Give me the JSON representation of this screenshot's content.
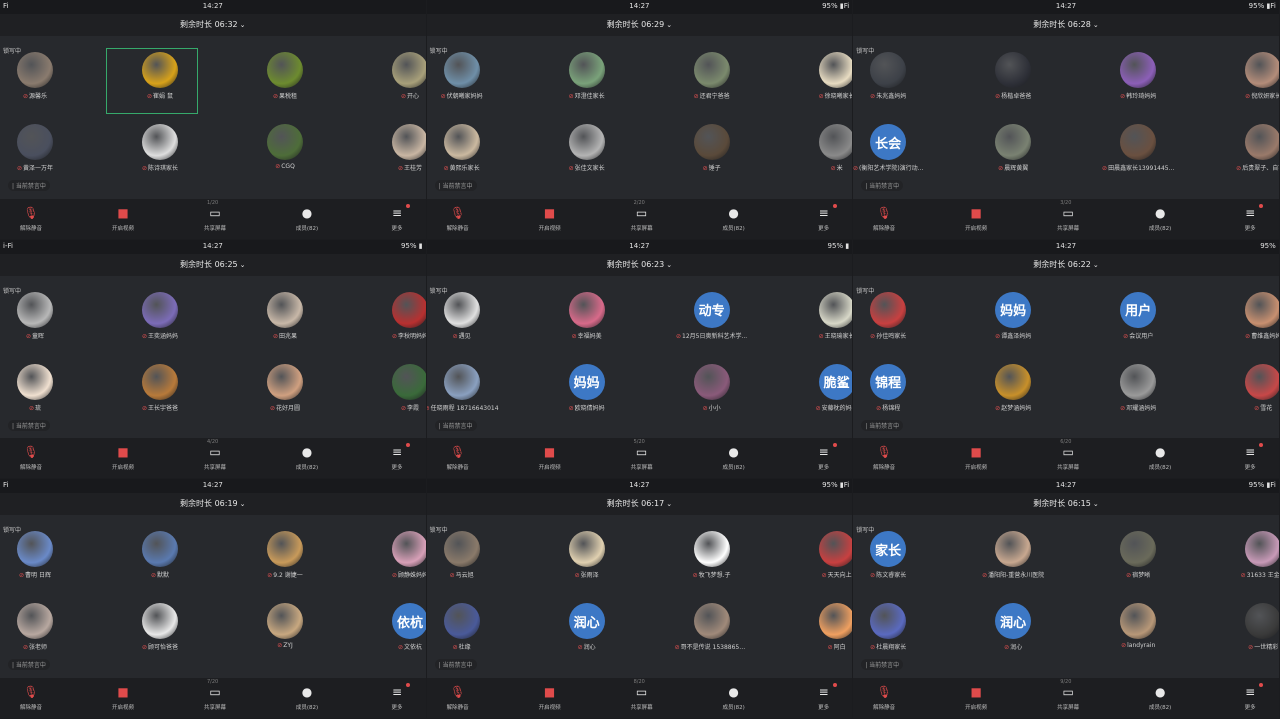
{
  "colors": {
    "accent_green": "#36a96b",
    "avatar_blue": "#3d78c5",
    "mic_red": "#e04b4b"
  },
  "toolbar_labels": [
    "解除静音",
    "开启视频",
    "共享屏幕",
    "成员(82)",
    "更多"
  ],
  "toolbar_icons": [
    "mic-off-icon",
    "video-off-icon",
    "share-screen-icon",
    "members-icon",
    "more-icon"
  ],
  "speaking_label": "锁写中",
  "screen_share_label": "| 当前禁言中",
  "tiles": [
    {
      "status": {
        "wifi": "Fi",
        "time": "14:27",
        "battery": ""
      },
      "timer": "剩余时长 06:32",
      "page": "1/20",
      "participants": [
        {
          "name": "源馨乐",
          "color": "#8a7b6e"
        },
        {
          "name": "崔娟 鼠",
          "color": "#d8a21a"
        },
        {
          "name": "果税租",
          "color": "#6d8b2f"
        },
        {
          "name": "开心",
          "color": "#a8a07a"
        },
        {
          "name": "黄泽一万年",
          "color": "#4a4f5e"
        },
        {
          "name": "陈诗琪家长",
          "color": "#dedede"
        },
        {
          "name": "CGQ",
          "color": "#4e6d39"
        },
        {
          "name": "王桂芳",
          "color": "#c9b6a3"
        }
      ]
    },
    {
      "status": {
        "wifi": "",
        "time": "14:27",
        "battery": "95% ▮Fi"
      },
      "timer": "剩余时长 06:29",
      "page": "2/20",
      "participants": [
        {
          "name": "伏朝曦家妈妈",
          "color": "#6f8fa8"
        },
        {
          "name": "邓澄佳家长",
          "color": "#7aa27a"
        },
        {
          "name": "还君宁爸爸",
          "color": "#7b8a6d"
        },
        {
          "name": "徐晓曦家长",
          "color": "#e8dcc2"
        },
        {
          "name": "黄熙乐家长",
          "color": "#cbb9a0"
        },
        {
          "name": "张佳文家长",
          "color": "#b4b4b4"
        },
        {
          "name": "锤子",
          "color": "#5a4a3a"
        },
        {
          "name": "米",
          "color": "#8a8a8a"
        }
      ]
    },
    {
      "status": {
        "wifi": "",
        "time": "14:27",
        "battery": "95% ▮Fi"
      },
      "timer": "剩余时长 06:28",
      "page": "3/20",
      "participants": [
        {
          "name": "朱兆鑫妈妈",
          "color": "#3d4148"
        },
        {
          "name": "杨楷卓爸爸",
          "color": "#2e3038"
        },
        {
          "name": "韩玲琦妈妈",
          "color": "#8c5fb8"
        },
        {
          "name": "倪欣妍家长",
          "color": "#b48d7a"
        },
        {
          "text": "长会",
          "name": "(衡阳艺术学院)演行动...",
          "color": "#3d78c5"
        },
        {
          "name": "晨辉黄翼",
          "color": "#7a8272"
        },
        {
          "name": "田晨鑫家长13991445...",
          "color": "#6a5040"
        },
        {
          "name": "后贵翠子、自写字",
          "color": "#9a7a6a"
        }
      ]
    },
    {
      "status": {
        "wifi": "i-Fi",
        "time": "14:27",
        "battery": "95% ▮"
      },
      "timer": "剩余时长 06:25",
      "page": "4/20",
      "participants": [
        {
          "name": "童晖",
          "color": "#b8b8b8"
        },
        {
          "name": "王奕涵妈妈",
          "color": "#7c6cb8"
        },
        {
          "name": "田兆果",
          "color": "#c8b8a8"
        },
        {
          "name": "李秋明妈妈",
          "color": "#b83030"
        },
        {
          "name": "琉",
          "color": "#f0e0d0"
        },
        {
          "name": "王长宇爸爸",
          "color": "#b87a3a"
        },
        {
          "name": "花好月圆",
          "color": "#d0a080"
        },
        {
          "name": "李霞",
          "color": "#3a6a3a"
        }
      ]
    },
    {
      "status": {
        "wifi": "",
        "time": "14:27",
        "battery": "95% ▮"
      },
      "timer": "剩余时长 06:23",
      "page": "5/20",
      "participants": [
        {
          "name": "遇见",
          "color": "#e0e0e0"
        },
        {
          "name": "幸福妈美",
          "color": "#d86a8a"
        },
        {
          "text": "动专",
          "name": "12月5日奥新科艺术学...",
          "color": "#3d78c5"
        },
        {
          "name": "王晓瑜家长",
          "color": "#d8d8c8"
        },
        {
          "name": "任晓雨程 18716643014",
          "color": "#8aa0c0"
        },
        {
          "text": "妈妈",
          "name": "欧晓倩妈妈",
          "color": "#3d78c5"
        },
        {
          "name": "小小",
          "color": "#8a5a7a"
        },
        {
          "text": "脆鲨",
          "name": "安藤枕的妈妈",
          "color": "#3d78c5"
        }
      ]
    },
    {
      "status": {
        "wifi": "",
        "time": "14:27",
        "battery": "95%"
      },
      "timer": "剩余时长 06:22",
      "page": "6/20",
      "participants": [
        {
          "name": "孙佳鸣家长",
          "color": "#c84040"
        },
        {
          "text": "妈妈",
          "name": "谭鑫泽妈妈",
          "color": "#3d78c5"
        },
        {
          "text": "用户",
          "name": "会议用户",
          "color": "#3d78c5"
        },
        {
          "name": "曹维鑫妈妈",
          "color": "#c89070"
        },
        {
          "text": "锦程",
          "name": "杨锦程",
          "color": "#3d78c5"
        },
        {
          "name": "赵梦涵妈妈",
          "color": "#c8902a"
        },
        {
          "name": "邓耀涵妈妈",
          "color": "#9a9a9a"
        },
        {
          "name": "雪花",
          "color": "#c84848"
        }
      ]
    },
    {
      "status": {
        "wifi": "Fi",
        "time": "14:27",
        "battery": ""
      },
      "timer": "剩余时长 06:19",
      "page": "7/20",
      "participants": [
        {
          "name": "曹明 日辉",
          "color": "#6a8ac8"
        },
        {
          "name": "默默",
          "color": "#5a7ab0"
        },
        {
          "name": "9.2 谢婕一",
          "color": "#c89a5a"
        },
        {
          "name": "顾静姝妈妈",
          "color": "#d8a0b8"
        },
        {
          "name": "张老师",
          "color": "#b8a8a0"
        },
        {
          "name": "顾可怡爸爸",
          "color": "#e8e8e8"
        },
        {
          "name": "ZYJ",
          "color": "#c8a880"
        },
        {
          "text": "依杭",
          "name": "文依杭",
          "color": "#3d78c5"
        }
      ]
    },
    {
      "status": {
        "wifi": "",
        "time": "14:27",
        "battery": "95% ▮Fi"
      },
      "timer": "剩余时长 06:17",
      "page": "8/20",
      "participants": [
        {
          "name": "马云旭",
          "color": "#8a7a6a"
        },
        {
          "name": "张雨泽",
          "color": "#e0d0b0"
        },
        {
          "name": "牧飞梦想.子",
          "color": "#ffffff"
        },
        {
          "name": "天天向上",
          "color": "#c84040"
        },
        {
          "name": "杜缘",
          "color": "#4a5a9a"
        },
        {
          "text": "润心",
          "name": "润心",
          "color": "#3d78c5"
        },
        {
          "name": "哥不是传说 153886556...",
          "color": "#a08a7a"
        },
        {
          "name": "阿白",
          "color": "#f0a060"
        }
      ]
    },
    {
      "status": {
        "wifi": "",
        "time": "14:27",
        "battery": "95% ▮Fi"
      },
      "timer": "剩余时长 06:15",
      "page": "9/20",
      "participants": [
        {
          "text": "家长",
          "name": "陈文睿家长",
          "color": "#3d78c5"
        },
        {
          "name": "潘阳阳-重营永川医院",
          "color": "#c8a890"
        },
        {
          "name": "宿梦晰",
          "color": "#6a6a5a"
        },
        {
          "name": "31633 王金桥",
          "color": "#c89ab8"
        },
        {
          "name": "杜晨翔家长",
          "color": "#5a6ac0"
        },
        {
          "text": "润心",
          "name": "润心",
          "color": "#3d78c5"
        },
        {
          "name": "landyrain",
          "color": "#b89878"
        },
        {
          "name": "一世精彩",
          "color": "#3a3a3a"
        }
      ]
    }
  ]
}
